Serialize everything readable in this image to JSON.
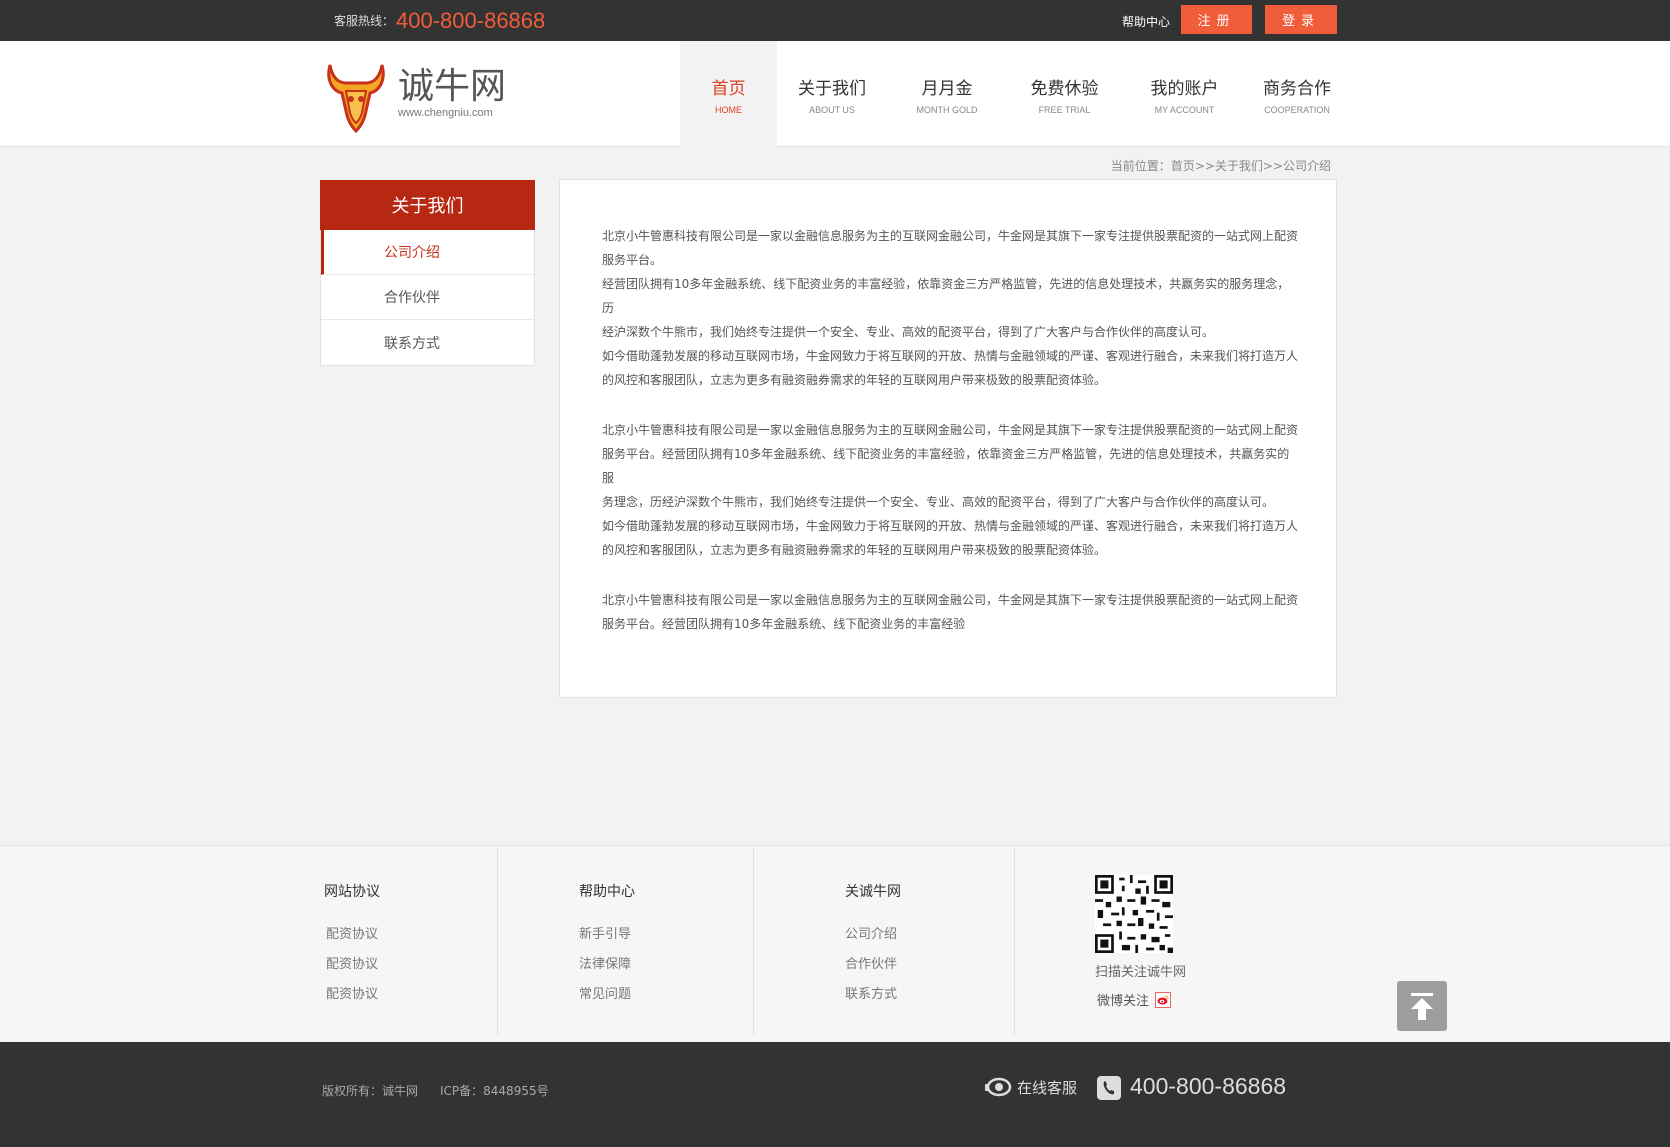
{
  "topbar": {
    "hotline_label": "客服热线：",
    "hotline_number": "400-800-86868",
    "help": "帮助中心",
    "register": "注册",
    "login": "登录"
  },
  "logo": {
    "name": "诚牛网",
    "url_text": "www.chengniu.com"
  },
  "nav": [
    {
      "cn": "首页",
      "en": "HOME"
    },
    {
      "cn": "关于我们",
      "en": "ABOUT US"
    },
    {
      "cn": "月月金",
      "en": "MONTH GOLD"
    },
    {
      "cn": "免费休验",
      "en": "FREE TRIAL"
    },
    {
      "cn": "我的账户",
      "en": "MY ACCOUNT"
    },
    {
      "cn": "商务合作",
      "en": "COOPERATION"
    }
  ],
  "breadcrumb": "当前位置：首页>>关于我们>>公司介绍",
  "sidebar": {
    "title": "关于我们",
    "items": [
      {
        "label": "公司介绍"
      },
      {
        "label": "合作伙伴"
      },
      {
        "label": "联系方式"
      }
    ]
  },
  "content": {
    "paragraphs": [
      [
        "北京小牛管惠科技有限公司是一家以金融信息服务为主的互联网金融公司，牛金网是其旗下一家专注提供股票配资的一站式网上配资",
        "服务平台。",
        "经营团队拥有10多年金融系统、线下配资业务的丰富经验，依靠资金三方严格监管，先进的信息处理技术，共赢务实的服务理念，历",
        "经沪深数个牛熊市，我们始终专注提供一个安全、专业、高效的配资平台，得到了广大客户与合作伙伴的高度认可。",
        "如今借助蓬勃发展的移动互联网市场，牛金网致力于将互联网的开放、热情与金融领域的严谨、客观进行融合，未来我们将打造万人",
        "的风控和客服团队，立志为更多有融资融券需求的年轻的互联网用户带来极致的股票配资体验。"
      ],
      [
        "北京小牛管惠科技有限公司是一家以金融信息服务为主的互联网金融公司，牛金网是其旗下一家专注提供股票配资的一站式网上配资",
        "服务平台。经营团队拥有10多年金融系统、线下配资业务的丰富经验，依靠资金三方严格监管，先进的信息处理技术，共赢务实的服",
        "务理念，历经沪深数个牛熊市，我们始终专注提供一个安全、专业、高效的配资平台，得到了广大客户与合作伙伴的高度认可。",
        "如今借助蓬勃发展的移动互联网市场，牛金网致力于将互联网的开放、热情与金融领域的严谨、客观进行融合，未来我们将打造万人",
        "的风控和客服团队，立志为更多有融资融券需求的年轻的互联网用户带来极致的股票配资体验。"
      ],
      [
        "北京小牛管惠科技有限公司是一家以金融信息服务为主的互联网金融公司，牛金网是其旗下一家专注提供股票配资的一站式网上配资",
        "服务平台。经营团队拥有10多年金融系统、线下配资业务的丰富经验"
      ]
    ]
  },
  "footer": {
    "columns": [
      {
        "title": "网站协议",
        "links": [
          "配资协议",
          "配资协议",
          "配资协议"
        ]
      },
      {
        "title": "帮助中心",
        "links": [
          "新手引导",
          "法律保障",
          "常见问题"
        ]
      },
      {
        "title": "关诚牛网",
        "links": [
          "公司介绍",
          "合作伙伴",
          "联系方式"
        ]
      }
    ],
    "qr_label": "扫描关注诚牛网",
    "weibo": "微博关注",
    "copyright": "版权所有：诚牛网",
    "icp": "ICP备：8448955号",
    "online_service": "在线客服",
    "phone": "400-800-86868"
  },
  "colors": {
    "accent": "#f15c3a",
    "brand_red": "#b72812",
    "dark_bar": "#333333"
  }
}
